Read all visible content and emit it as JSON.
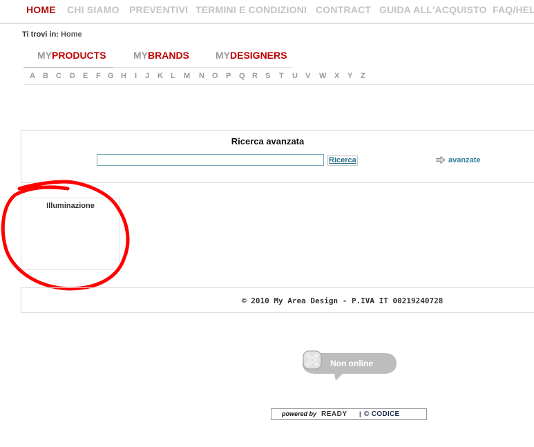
{
  "nav": {
    "items": [
      {
        "label": "HOME",
        "active": true
      },
      {
        "label": "CHI SIAMO",
        "active": false
      },
      {
        "label": "PREVENTIVI",
        "active": false
      },
      {
        "label": "TERMINI E CONDIZIONI",
        "active": false
      },
      {
        "label": "CONTRACT",
        "active": false
      },
      {
        "label": "GUIDA ALL'ACQUISTO",
        "active": false
      },
      {
        "label": "FAQ/HEL",
        "active": false
      }
    ]
  },
  "breadcrumb": {
    "prefix": "Ti trovi in:",
    "current": "Home"
  },
  "tabs": [
    {
      "prefix": "MY",
      "main": "PRODUCTS"
    },
    {
      "prefix": "MY",
      "main": "BRANDS"
    },
    {
      "prefix": "MY",
      "main": "DESIGNERS"
    }
  ],
  "alphabet": [
    "A",
    "B",
    "C",
    "D",
    "E",
    "F",
    "G",
    "H",
    "I",
    "J",
    "K",
    "L",
    "M",
    "N",
    "O",
    "P",
    "Q",
    "R",
    "S",
    "T",
    "U",
    "V",
    "W",
    "X",
    "Y",
    "Z"
  ],
  "search": {
    "title": "Ricerca avanzata",
    "value": "",
    "button_label": "Ricerca",
    "advanced_label": "avanzate"
  },
  "category": {
    "title": "Illuminazione"
  },
  "footer": {
    "text": "© 2010 My Area Design - P.IVA IT 00219240728"
  },
  "status": {
    "text": "Non online"
  },
  "powered": {
    "label": "powered by",
    "ready": "READY",
    "sep": "|",
    "codice": "© CODICE"
  },
  "colors": {
    "accent": "#b40b10",
    "nav_inactive": "#c3c3c3",
    "link": "#2f7d9c",
    "annotation": "#ff0000"
  },
  "icons": [
    "arrow-right-icon",
    "close-x-icon"
  ]
}
